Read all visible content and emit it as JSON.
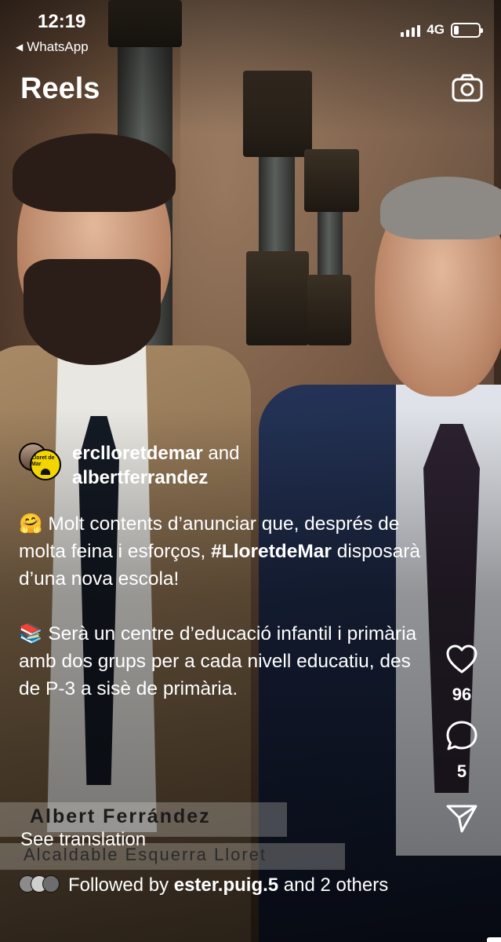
{
  "status_bar": {
    "time": "12:19",
    "back_app": "WhatsApp",
    "network": "4G",
    "battery_level": 0.2
  },
  "header": {
    "title": "Reels",
    "camera_icon": "camera-icon"
  },
  "post": {
    "author_1": "erclloretdemar",
    "joiner": "and",
    "author_2": "albertferrandez",
    "avatar_2_text": "Lloret de Mar",
    "caption": {
      "emoji_1": "🤗",
      "line_1_rest": " Molt contents d’anunciar que, després de molta feina i esforços, ",
      "hashtag": "#LloretdeMar",
      "line_1_end": " disposarà d’una nova escola!",
      "emoji_2": "📚",
      "paragraph_2": " Serà un centre d’educació infantil i primària amb dos grups per a cada nivell educatiu, des de P-3 a sisè de primària."
    },
    "see_translation": "See translation",
    "followed_prefix": "Followed by",
    "followed_user": "ester.puig.5",
    "followed_suffix": "and 2 others"
  },
  "video_overlay": {
    "name": "Albert Ferrández",
    "role": "Alcaldable Esquerra Lloret"
  },
  "actions": {
    "likes": "96",
    "comments": "5"
  },
  "colors": {
    "text": "#ffffff",
    "overlay_band": "#e6e1dc",
    "avatar_yellow": "#f3d500"
  }
}
